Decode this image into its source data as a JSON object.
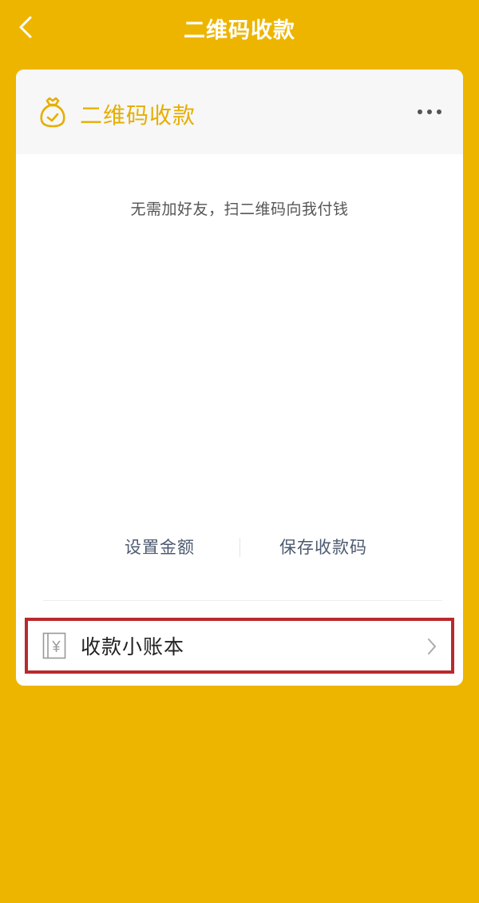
{
  "colors": {
    "background": "#EDB500",
    "accent": "#E6AE00",
    "highlight_border": "#B8292E"
  },
  "topbar": {
    "back_icon": "chevron-left-icon",
    "title": "二维码收款"
  },
  "card": {
    "icon": "moneybag-icon",
    "title": "二维码收款",
    "more_icon": "more-horizontal-icon",
    "hint": "无需加好友，扫二维码向我付钱",
    "actions": {
      "set_amount": "设置金额",
      "save_code": "保存收款码"
    },
    "ledger": {
      "icon": "ledger-yen-icon",
      "label": "收款小账本",
      "chevron_icon": "chevron-right-icon"
    }
  }
}
